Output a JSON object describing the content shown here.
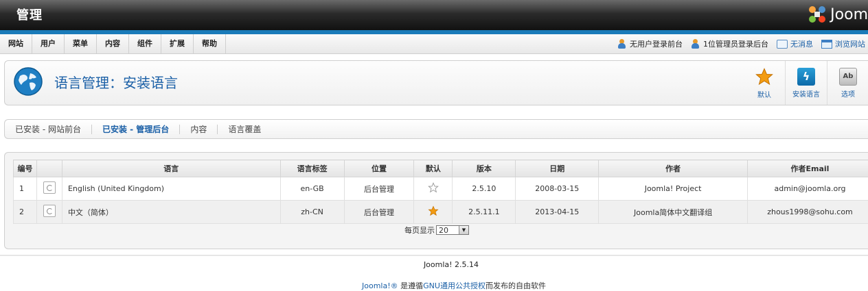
{
  "header": {
    "title": "管理",
    "logo_text": "Joom"
  },
  "menu": [
    "网站",
    "用户",
    "菜单",
    "内容",
    "组件",
    "扩展",
    "帮助"
  ],
  "status": {
    "frontend_users": "无用户登录前台",
    "backend_admins": "1位管理员登录后台",
    "messages": "无消息",
    "view_site": "浏览网站"
  },
  "toolbar": {
    "title": "语言管理：安装语言",
    "buttons": [
      "默认",
      "安装语言",
      "选项"
    ],
    "options_icon_glyph": "Ab"
  },
  "subnav": {
    "tabs": [
      "已安装 - 网站前台",
      "已安装 - 管理后台",
      "内容",
      "语言覆盖"
    ],
    "active_index": 1
  },
  "table": {
    "headers": [
      "编号",
      "",
      "语言",
      "语言标签",
      "位置",
      "默认",
      "版本",
      "日期",
      "作者",
      "作者Email"
    ],
    "rows": [
      {
        "num": "1",
        "language": "English (United Kingdom)",
        "tag": "en-GB",
        "location": "后台管理",
        "default": false,
        "version": "2.5.10",
        "date": "2008-03-15",
        "author": "Joomla! Project",
        "email": "admin@joomla.org"
      },
      {
        "num": "2",
        "language": "中文（简体）",
        "tag": "zh-CN",
        "location": "后台管理",
        "default": true,
        "version": "2.5.11.1",
        "date": "2013-04-15",
        "author": "Joomla简体中文翻译组",
        "email": "zhous1998@sohu.com"
      }
    ]
  },
  "pagination": {
    "label": "每页显示",
    "value": "20"
  },
  "footer": {
    "version": "Joomla! 2.5.14",
    "license_brand": "Joomla!®",
    "license_pre": " 是遵循",
    "license_link": "GNU通用公共授权",
    "license_post": "而发布的自由软件"
  },
  "colors": {
    "accent_blue": "#1a7bb9",
    "link": "#1a5fa6",
    "star": "#f39c12"
  }
}
